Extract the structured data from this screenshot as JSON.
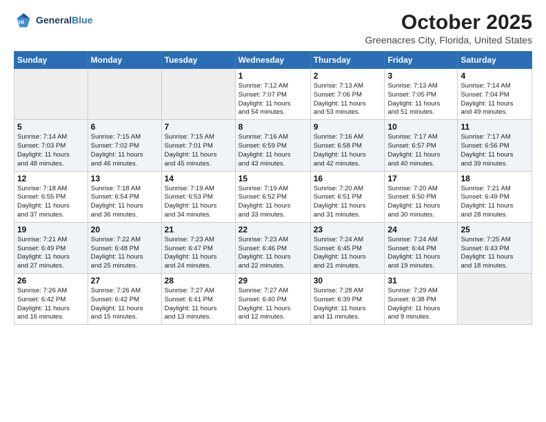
{
  "header": {
    "logo_line1": "General",
    "logo_line2": "Blue",
    "month_title": "October 2025",
    "location": "Greenacres City, Florida, United States"
  },
  "weekdays": [
    "Sunday",
    "Monday",
    "Tuesday",
    "Wednesday",
    "Thursday",
    "Friday",
    "Saturday"
  ],
  "weeks": [
    [
      {
        "day": "",
        "info": ""
      },
      {
        "day": "",
        "info": ""
      },
      {
        "day": "",
        "info": ""
      },
      {
        "day": "1",
        "info": "Sunrise: 7:12 AM\nSunset: 7:07 PM\nDaylight: 11 hours\nand 54 minutes."
      },
      {
        "day": "2",
        "info": "Sunrise: 7:13 AM\nSunset: 7:06 PM\nDaylight: 11 hours\nand 53 minutes."
      },
      {
        "day": "3",
        "info": "Sunrise: 7:13 AM\nSunset: 7:05 PM\nDaylight: 11 hours\nand 51 minutes."
      },
      {
        "day": "4",
        "info": "Sunrise: 7:14 AM\nSunset: 7:04 PM\nDaylight: 11 hours\nand 49 minutes."
      }
    ],
    [
      {
        "day": "5",
        "info": "Sunrise: 7:14 AM\nSunset: 7:03 PM\nDaylight: 11 hours\nand 48 minutes."
      },
      {
        "day": "6",
        "info": "Sunrise: 7:15 AM\nSunset: 7:02 PM\nDaylight: 11 hours\nand 46 minutes."
      },
      {
        "day": "7",
        "info": "Sunrise: 7:15 AM\nSunset: 7:01 PM\nDaylight: 11 hours\nand 45 minutes."
      },
      {
        "day": "8",
        "info": "Sunrise: 7:16 AM\nSunset: 6:59 PM\nDaylight: 11 hours\nand 43 minutes."
      },
      {
        "day": "9",
        "info": "Sunrise: 7:16 AM\nSunset: 6:58 PM\nDaylight: 11 hours\nand 42 minutes."
      },
      {
        "day": "10",
        "info": "Sunrise: 7:17 AM\nSunset: 6:57 PM\nDaylight: 11 hours\nand 40 minutes."
      },
      {
        "day": "11",
        "info": "Sunrise: 7:17 AM\nSunset: 6:56 PM\nDaylight: 11 hours\nand 39 minutes."
      }
    ],
    [
      {
        "day": "12",
        "info": "Sunrise: 7:18 AM\nSunset: 6:55 PM\nDaylight: 11 hours\nand 37 minutes."
      },
      {
        "day": "13",
        "info": "Sunrise: 7:18 AM\nSunset: 6:54 PM\nDaylight: 11 hours\nand 36 minutes."
      },
      {
        "day": "14",
        "info": "Sunrise: 7:19 AM\nSunset: 6:53 PM\nDaylight: 11 hours\nand 34 minutes."
      },
      {
        "day": "15",
        "info": "Sunrise: 7:19 AM\nSunset: 6:52 PM\nDaylight: 11 hours\nand 33 minutes."
      },
      {
        "day": "16",
        "info": "Sunrise: 7:20 AM\nSunset: 6:51 PM\nDaylight: 11 hours\nand 31 minutes."
      },
      {
        "day": "17",
        "info": "Sunrise: 7:20 AM\nSunset: 6:50 PM\nDaylight: 11 hours\nand 30 minutes."
      },
      {
        "day": "18",
        "info": "Sunrise: 7:21 AM\nSunset: 6:49 PM\nDaylight: 11 hours\nand 28 minutes."
      }
    ],
    [
      {
        "day": "19",
        "info": "Sunrise: 7:21 AM\nSunset: 6:49 PM\nDaylight: 11 hours\nand 27 minutes."
      },
      {
        "day": "20",
        "info": "Sunrise: 7:22 AM\nSunset: 6:48 PM\nDaylight: 11 hours\nand 25 minutes."
      },
      {
        "day": "21",
        "info": "Sunrise: 7:23 AM\nSunset: 6:47 PM\nDaylight: 11 hours\nand 24 minutes."
      },
      {
        "day": "22",
        "info": "Sunrise: 7:23 AM\nSunset: 6:46 PM\nDaylight: 11 hours\nand 22 minutes."
      },
      {
        "day": "23",
        "info": "Sunrise: 7:24 AM\nSunset: 6:45 PM\nDaylight: 11 hours\nand 21 minutes."
      },
      {
        "day": "24",
        "info": "Sunrise: 7:24 AM\nSunset: 6:44 PM\nDaylight: 11 hours\nand 19 minutes."
      },
      {
        "day": "25",
        "info": "Sunrise: 7:25 AM\nSunset: 6:43 PM\nDaylight: 11 hours\nand 18 minutes."
      }
    ],
    [
      {
        "day": "26",
        "info": "Sunrise: 7:26 AM\nSunset: 6:42 PM\nDaylight: 11 hours\nand 16 minutes."
      },
      {
        "day": "27",
        "info": "Sunrise: 7:26 AM\nSunset: 6:42 PM\nDaylight: 11 hours\nand 15 minutes."
      },
      {
        "day": "28",
        "info": "Sunrise: 7:27 AM\nSunset: 6:41 PM\nDaylight: 11 hours\nand 13 minutes."
      },
      {
        "day": "29",
        "info": "Sunrise: 7:27 AM\nSunset: 6:40 PM\nDaylight: 11 hours\nand 12 minutes."
      },
      {
        "day": "30",
        "info": "Sunrise: 7:28 AM\nSunset: 6:39 PM\nDaylight: 11 hours\nand 11 minutes."
      },
      {
        "day": "31",
        "info": "Sunrise: 7:29 AM\nSunset: 6:38 PM\nDaylight: 11 hours\nand 9 minutes."
      },
      {
        "day": "",
        "info": ""
      }
    ]
  ]
}
